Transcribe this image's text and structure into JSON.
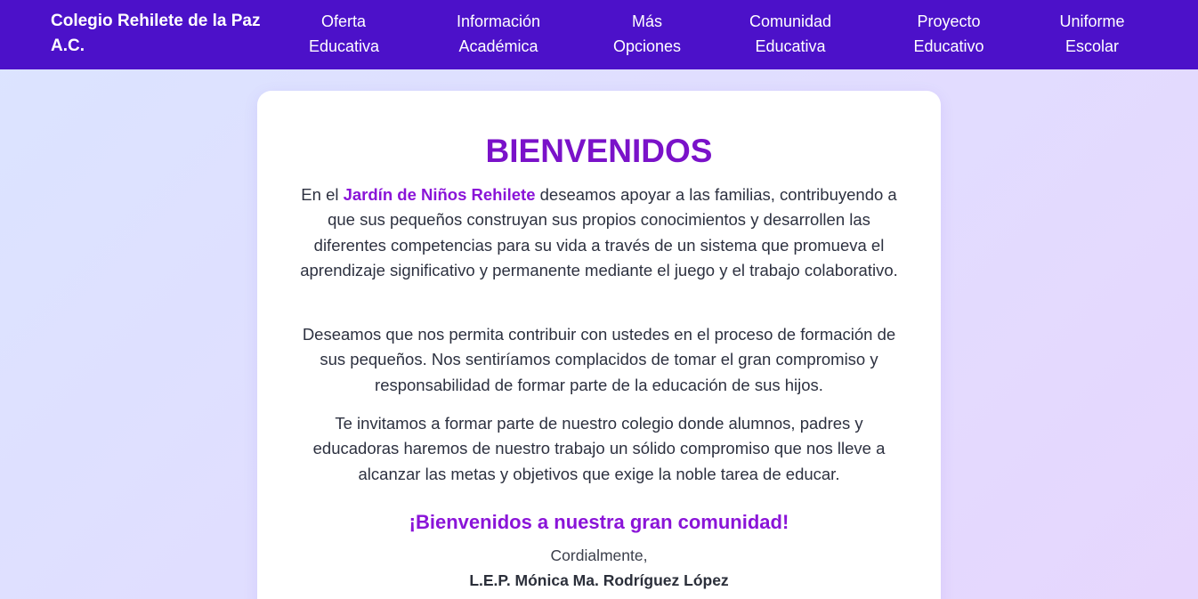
{
  "header": {
    "brand": "Colegio Rehilete de la Paz A.C.",
    "nav": [
      "Oferta\nEducativa",
      "Información\nAcadémica",
      "Más\nOpciones",
      "Comunidad\nEducativa",
      "Proyecto\nEducativo",
      "Uniforme\nEscolar"
    ]
  },
  "welcome": {
    "title": "BIENVENIDOS",
    "p1_before": "En el ",
    "p1_highlight": "Jardín de Niños Rehilete",
    "p1_after": " deseamos apoyar a las familias, contribuyendo a que sus pequeños construyan sus propios conocimientos y desarrollen las diferentes competencias para su vida a través de un sistema que promueva el aprendizaje significativo y permanente mediante el juego y el trabajo colaborativo.",
    "p2": "Deseamos que nos permita contribuir con ustedes en el proceso de formación de sus pequeños. Nos sentiríamos complacidos de tomar el gran compromiso y responsabilidad de formar parte de la educación de sus hijos.",
    "p3": "Te invitamos a formar parte de nuestro colegio donde alumnos, padres y educadoras haremos de nuestro trabajo un sólido compromiso que nos lleve a alcanzar las metas y objetivos que exige la noble tarea de educar.",
    "closing": "¡Bienvenidos a nuestra gran comunidad!",
    "regards": "Cordialmente,",
    "signature": "L.E.P. Mónica Ma. Rodríguez López"
  },
  "colors": {
    "navbar": "#4c11c9",
    "accent": "#8a14d8",
    "title": "#7a12c9"
  }
}
